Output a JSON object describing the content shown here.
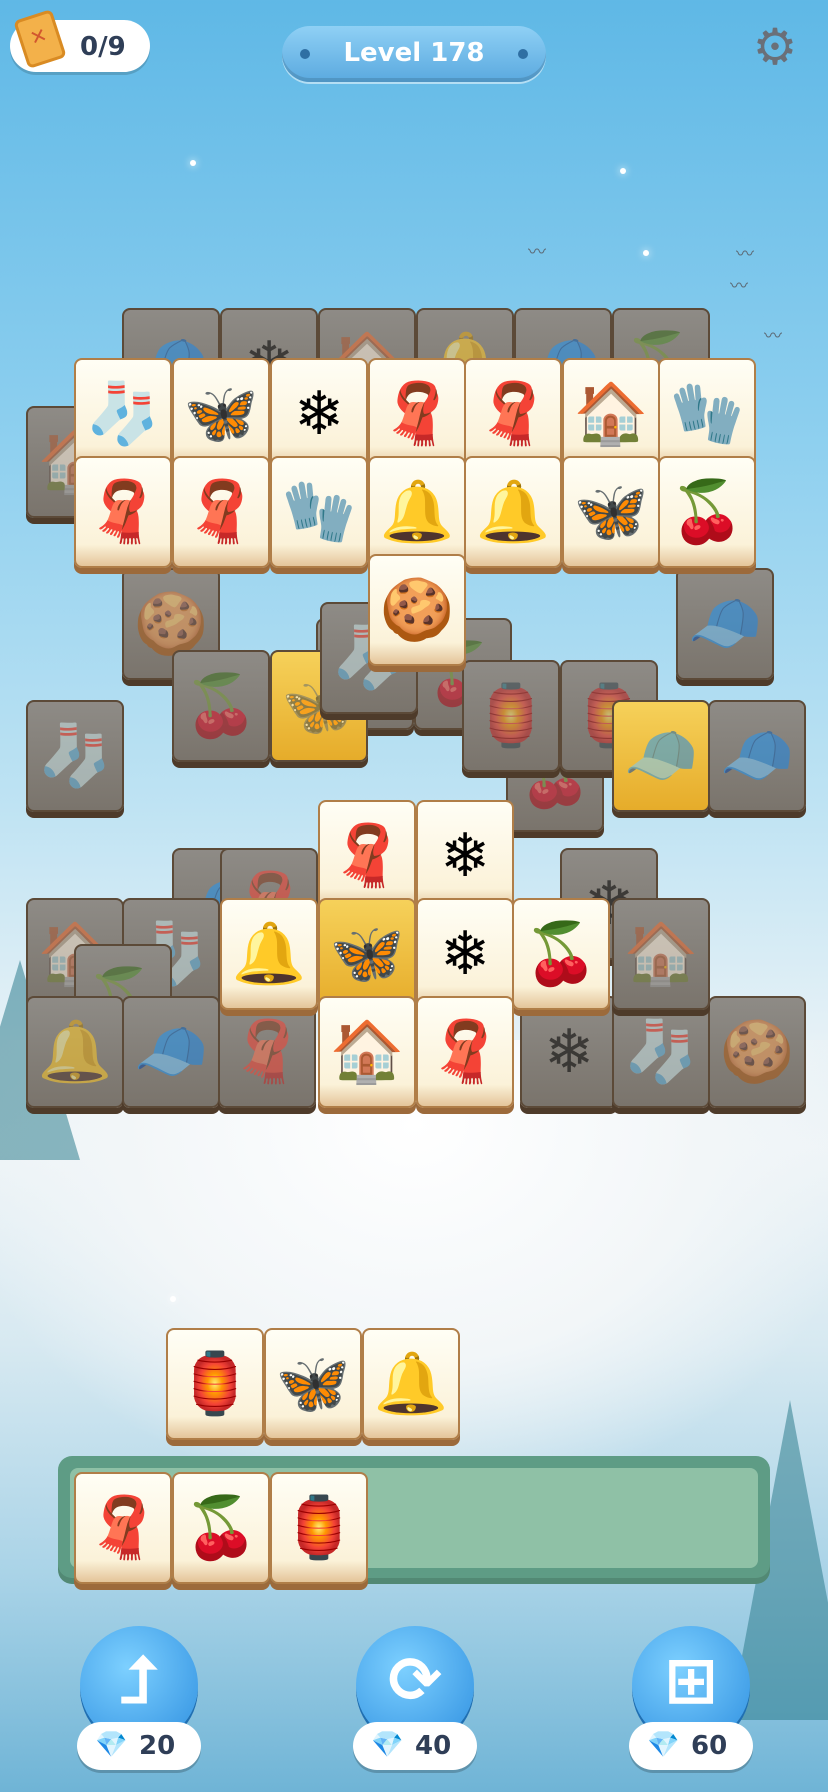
{
  "hud": {
    "collected": "0/9",
    "level": "Level 178",
    "settings_icon": "gear-icon"
  },
  "tiles": {
    "stocking": "🧦",
    "butterfly": "🦋",
    "snowflake": "❄",
    "scarf": "🧣",
    "gingerhouse": "🏠",
    "mittens": "🧤",
    "bell": "🔔",
    "holly": "🍒",
    "gingerman": "🍪",
    "hat": "🧢",
    "ornament": "🏮"
  },
  "board": {
    "dim": [
      "hat",
      "snowflake",
      "gingerhouse",
      "bell",
      "hat",
      "holly",
      "gingerhouse",
      "gingerman",
      "gingerman",
      "holly",
      "hat",
      "stocking",
      "holly",
      "butterfly",
      "stocking",
      "holly",
      "ornament",
      "ornament",
      "hat",
      "hat",
      "hat",
      "scarf",
      "snowflake",
      "gingerhouse",
      "stocking",
      "holly",
      "snowflake",
      "stocking",
      "gingerman",
      "bell",
      "hat",
      "scarf",
      "gingerhouse"
    ],
    "front": [
      "stocking",
      "butterfly",
      "snowflake",
      "scarf",
      "scarf",
      "gingerhouse",
      "mittens",
      "scarf",
      "scarf",
      "mittens",
      "bell",
      "bell",
      "butterfly",
      "holly",
      "gingerman",
      "scarf",
      "snowflake",
      "bell",
      "butterfly",
      "snowflake",
      "holly",
      "gingerhouse",
      "scarf"
    ]
  },
  "staging": [
    "ornament",
    "butterfly",
    "bell"
  ],
  "tray": [
    "scarf",
    "holly",
    "ornament"
  ],
  "powerups": [
    {
      "name": "undo",
      "icon": "undo-arrow-icon",
      "symbol": "⮥",
      "cost": "20"
    },
    {
      "name": "shuffle",
      "icon": "shuffle-icon",
      "symbol": "⟳",
      "cost": "40"
    },
    {
      "name": "extra-slot",
      "icon": "add-slot-icon",
      "symbol": "⊞",
      "cost": "60"
    }
  ],
  "gem_symbol": "💎"
}
